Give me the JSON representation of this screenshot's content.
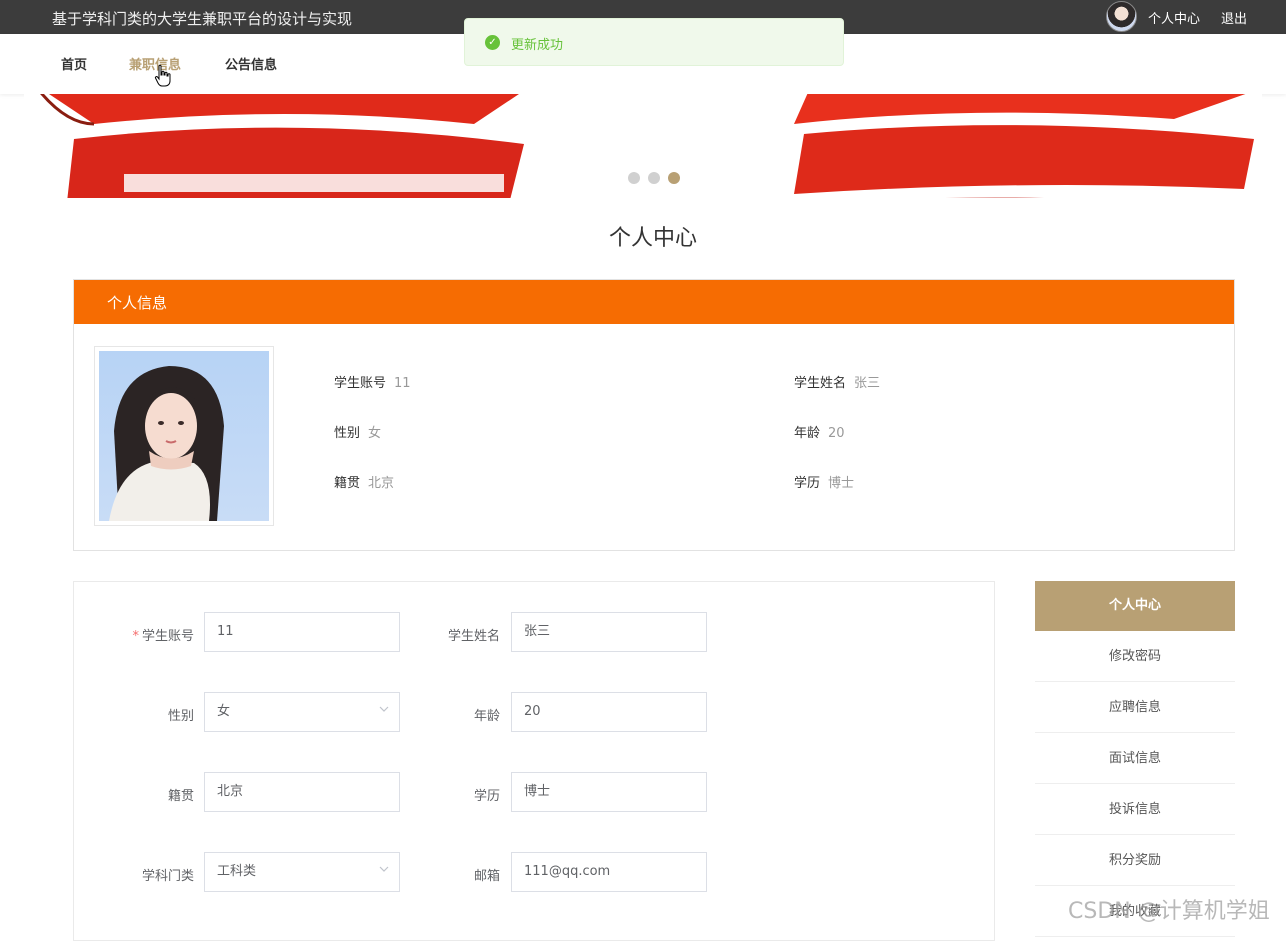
{
  "topbar": {
    "site_title": "基于学科门类的大学生兼职平台的设计与实现",
    "user_center": "个人中心",
    "logout": "退出"
  },
  "nav": {
    "items": [
      {
        "label": "首页"
      },
      {
        "label": "兼职信息"
      },
      {
        "label": "公告信息"
      }
    ],
    "active": "兼职信息"
  },
  "toast": {
    "message": "更新成功",
    "icon": "check-circle-icon"
  },
  "banner": {
    "slide_count": 3,
    "active_slide": 3
  },
  "page_title": "个人中心",
  "info_card": {
    "header": "个人信息",
    "fields": [
      {
        "label": "学生账号",
        "value": "11"
      },
      {
        "label": "学生姓名",
        "value": "张三"
      },
      {
        "label": "性别",
        "value": "女"
      },
      {
        "label": "年龄",
        "value": "20"
      },
      {
        "label": "籍贯",
        "value": "北京"
      },
      {
        "label": "学历",
        "value": "博士"
      }
    ]
  },
  "form": {
    "account_label": "学生账号",
    "account_value": "11",
    "name_label": "学生姓名",
    "name_value": "张三",
    "gender_label": "性别",
    "gender_value": "女",
    "age_label": "年龄",
    "age_value": "20",
    "hometown_label": "籍贯",
    "hometown_value": "北京",
    "education_label": "学历",
    "education_value": "博士",
    "discipline_label": "学科门类",
    "discipline_value": "工科类",
    "email_label": "邮箱",
    "email_value": "111@qq.com",
    "required_mark": "*"
  },
  "side_menu": {
    "items": [
      {
        "label": "个人中心"
      },
      {
        "label": "修改密码"
      },
      {
        "label": "应聘信息"
      },
      {
        "label": "面试信息"
      },
      {
        "label": "投诉信息"
      },
      {
        "label": "积分奖励"
      },
      {
        "label": "我的收藏"
      }
    ],
    "active": "个人中心"
  },
  "watermark": "CSDN @计算机学姐",
  "colors": {
    "accent": "#b8a074",
    "card_header": "#f66c02",
    "success": "#67c23a"
  }
}
